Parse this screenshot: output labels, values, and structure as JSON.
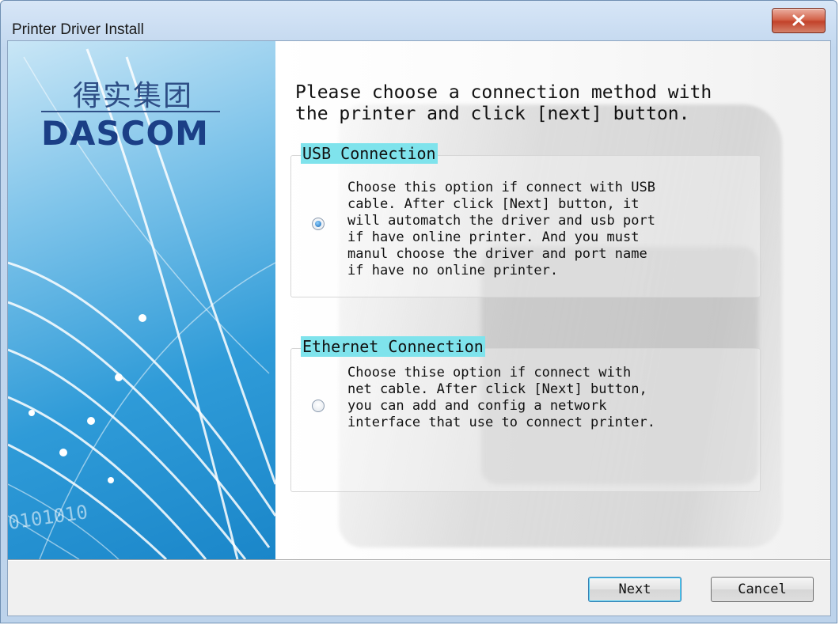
{
  "window": {
    "title": "Printer Driver Install"
  },
  "branding": {
    "cn_name": "得实集团",
    "en_name": "DASCOM",
    "decor_text": "0101010"
  },
  "instruction": "Please choose a connection method with\nthe printer and click [next] button.",
  "options": [
    {
      "label": "USB Connection",
      "selected": true,
      "description": "Choose this option if connect with USB\ncable. After click [Next] button, it\nwill automatch the driver and usb port\nif have online printer. And you must\nmanul choose the driver and port name\nif have no online printer."
    },
    {
      "label": "Ethernet Connection",
      "selected": false,
      "description": "Choose thise option if connect with\nnet cable. After click [Next] button,\nyou can add and config a network\ninterface that use to connect printer."
    }
  ],
  "buttons": {
    "next": "Next",
    "cancel": "Cancel"
  },
  "colors": {
    "group_label_highlight": "#7fe3ec",
    "close_button": "#c2422a",
    "panel_blue": "#2f9bd8"
  },
  "icons": {
    "close": "close-x-icon",
    "radio_on": "radio-selected-icon",
    "radio_off": "radio-unselected-icon"
  }
}
